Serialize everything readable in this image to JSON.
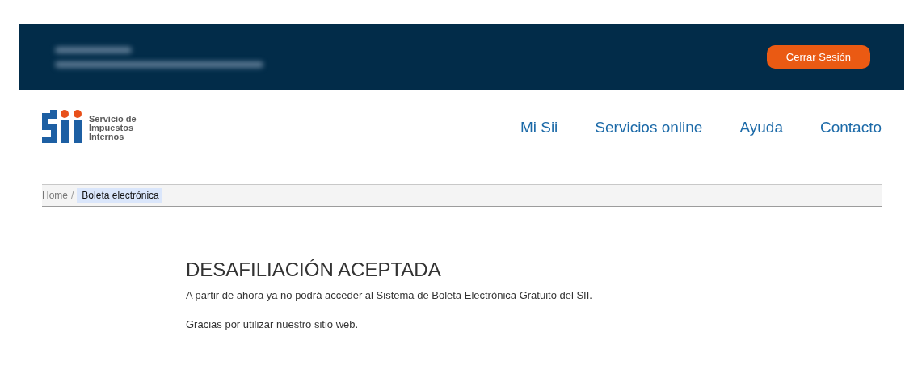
{
  "top_bar": {
    "logout_button": "Cerrar Sesión"
  },
  "logo": {
    "lines": [
      "Servicio de",
      "Impuestos",
      "Internos"
    ]
  },
  "nav": [
    {
      "label": "Mi Sii"
    },
    {
      "label": "Servicios online"
    },
    {
      "label": "Ayuda"
    },
    {
      "label": "Contacto"
    }
  ],
  "breadcrumb_separator": "/",
  "breadcrumb": [
    {
      "label": "Home",
      "selected": false
    },
    {
      "label": "Boleta electrónica",
      "selected": true
    }
  ],
  "content": {
    "title": "DESAFILIACIÓN ACEPTADA",
    "paragraphs": [
      "A partir de ahora ya no podrá acceder al Sistema de Boleta Electrónica Gratuito del SII.",
      "Gracias por utilizar nuestro sitio web."
    ]
  }
}
